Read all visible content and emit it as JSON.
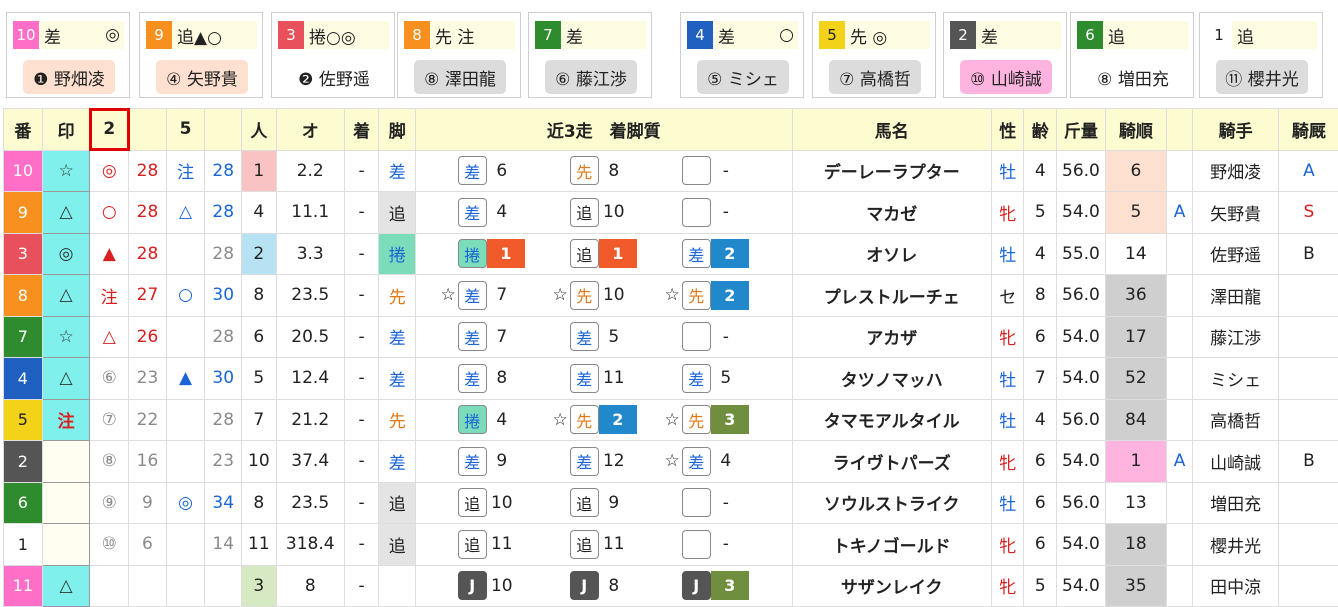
{
  "cards": [
    {
      "num": "10",
      "num_bg": "#ff6fc8",
      "mark": "差",
      "mark2": "◎",
      "jockey": "❶ 野畑凌",
      "jk_bg": "#fde0cf"
    },
    {
      "num": "9",
      "num_bg": "#f7901e",
      "mark": "追▲○",
      "mark2": "",
      "jockey": "④ 矢野貴",
      "jk_bg": "#fde0cf"
    },
    {
      "num": "3",
      "num_bg": "#e8505b",
      "mark": "捲○◎",
      "mark2": "",
      "jockey": "❷ 佐野遥",
      "jk_bg": "#ffffff"
    },
    {
      "num": "8",
      "num_bg": "#f7901e",
      "mark": "先 注",
      "mark2": "",
      "jockey": "⑧ 澤田龍",
      "jk_bg": "#dcdcdc"
    },
    {
      "num": "7",
      "num_bg": "#2e8b2e",
      "mark": "差",
      "mark2": "",
      "jockey": "⑥ 藤江渉",
      "jk_bg": "#dcdcdc"
    },
    {
      "num": "4",
      "num_bg": "#1f5fc0",
      "mark": "差",
      "mark2": "○",
      "jockey": "⑤ ミシェ",
      "jk_bg": "#dcdcdc"
    },
    {
      "num": "5",
      "num_bg": "#f3d31a",
      "mark": "先 ◎",
      "mark2": "",
      "jockey": "⑦ 高橋哲",
      "jk_bg": "#dcdcdc"
    },
    {
      "num": "2",
      "num_bg": "#555555",
      "mark": "差",
      "mark2": "",
      "jockey": "⑩ 山崎誠",
      "jk_bg": "#ffb4e0"
    },
    {
      "num": "6",
      "num_bg": "#2e8b2e",
      "mark": "追",
      "mark2": "",
      "jockey": "⑧ 増田充",
      "jk_bg": "#ffffff"
    },
    {
      "num": "1",
      "num_bg": "#ffffff",
      "mark": "追",
      "mark2": "",
      "jockey": "⑪ 櫻井光",
      "jk_bg": "#dcdcdc"
    }
  ],
  "headers": {
    "ban": "番",
    "mark": "印",
    "c2": "2",
    "c5": "5",
    "ninki": "人",
    "odds": "オ",
    "chaku": "着",
    "ashi": "脚",
    "recent": "近3走　着脚質",
    "name": "馬名",
    "sex": "性",
    "age": "齢",
    "kin": "斤量",
    "kijun": "騎順",
    "jockey": "騎手",
    "kikyu": "騎厩"
  },
  "rows": [
    {
      "ban": "10",
      "ban_bg": "#ff6fc8",
      "ban_fg": "#fff",
      "mark": "☆",
      "mark_style": "mark",
      "m2": "◎",
      "m2c": "red",
      "v2": "28",
      "v2c": "red",
      "m5": "注",
      "m5c": "blue",
      "v5": "28",
      "v5c": "blue",
      "ninki": "1",
      "ninki_bg": "#f9c3c3",
      "odds": "2.2",
      "chaku": "-",
      "ashi": "差",
      "ashi_c": "sa",
      "ashi_bg": "",
      "r": [
        {
          "st": "",
          "t": "差",
          "c": "sa",
          "n": "6",
          "rk": "",
          "rkbg": ""
        },
        {
          "st": "",
          "t": "先",
          "c": "se",
          "n": "8",
          "rk": "",
          "rkbg": ""
        },
        {
          "st": "",
          "t": "",
          "c": "blank",
          "n": "-",
          "rk": "",
          "rkbg": ""
        }
      ],
      "name": "デーレーラプター",
      "sex": "牡",
      "sexc": "blue",
      "age": "4",
      "kin": "56.0",
      "kijun": "6",
      "kj_bg": "#fde0cf",
      "a": "",
      "jockey": "野畑凌",
      "kikyu": "A",
      "kkc": "blue"
    },
    {
      "ban": "9",
      "ban_bg": "#f7901e",
      "ban_fg": "#fff",
      "mark": "△",
      "mark_style": "mark",
      "m2": "○",
      "m2c": "red",
      "v2": "28",
      "v2c": "red",
      "m5": "△",
      "m5c": "blue",
      "v5": "28",
      "v5c": "blue",
      "ninki": "4",
      "ninki_bg": "",
      "odds": "11.1",
      "chaku": "-",
      "ashi": "追",
      "ashi_c": "oi",
      "ashi_bg": "#e4e4e4",
      "r": [
        {
          "st": "",
          "t": "差",
          "c": "sa",
          "n": "4",
          "rk": "",
          "rkbg": ""
        },
        {
          "st": "",
          "t": "追",
          "c": "oi",
          "n": "10",
          "rk": "",
          "rkbg": ""
        },
        {
          "st": "",
          "t": "",
          "c": "blank",
          "n": "-",
          "rk": "",
          "rkbg": ""
        }
      ],
      "name": "マカゼ",
      "sex": "牝",
      "sexc": "red",
      "age": "5",
      "kin": "54.0",
      "kijun": "5",
      "kj_bg": "#fde0cf",
      "a": "A",
      "jockey": "矢野貴",
      "kikyu": "S",
      "kkc": "red"
    },
    {
      "ban": "3",
      "ban_bg": "#e8505b",
      "ban_fg": "#fff",
      "mark": "◎",
      "mark_style": "mark",
      "m2": "▲",
      "m2c": "red",
      "v2": "28",
      "v2c": "red",
      "m5": "",
      "m5c": "",
      "v5": "28",
      "v5c": "gray",
      "ninki": "2",
      "ninki_bg": "#b7e2f3",
      "odds": "3.3",
      "chaku": "-",
      "ashi": "捲",
      "ashi_c": "ma",
      "ashi_bg": "#7adcb8",
      "r": [
        {
          "st": "",
          "t": "捲",
          "c": "ma",
          "n": "",
          "rk": "1",
          "rkbg": "#f15a2a"
        },
        {
          "st": "",
          "t": "追",
          "c": "oi",
          "n": "",
          "rk": "1",
          "rkbg": "#f15a2a"
        },
        {
          "st": "",
          "t": "差",
          "c": "sa",
          "n": "",
          "rk": "2",
          "rkbg": "#2288cc"
        }
      ],
      "name": "オソレ",
      "sex": "牡",
      "sexc": "blue",
      "age": "4",
      "kin": "55.0",
      "kijun": "14",
      "kj_bg": "",
      "a": "",
      "jockey": "佐野遥",
      "kikyu": "B",
      "kkc": ""
    },
    {
      "ban": "8",
      "ban_bg": "#f7901e",
      "ban_fg": "#fff",
      "mark": "△",
      "mark_style": "mark",
      "m2": "注",
      "m2c": "red",
      "v2": "27",
      "v2c": "red",
      "m5": "○",
      "m5c": "blue",
      "v5": "30",
      "v5c": "blue",
      "ninki": "8",
      "ninki_bg": "",
      "odds": "23.5",
      "chaku": "-",
      "ashi": "先",
      "ashi_c": "se",
      "ashi_bg": "",
      "r": [
        {
          "st": "☆",
          "t": "差",
          "c": "sa",
          "n": "7",
          "rk": "",
          "rkbg": ""
        },
        {
          "st": "☆",
          "t": "先",
          "c": "se",
          "n": "10",
          "rk": "",
          "rkbg": ""
        },
        {
          "st": "☆",
          "t": "先",
          "c": "se",
          "n": "",
          "rk": "2",
          "rkbg": "#2288cc"
        }
      ],
      "name": "プレストルーチェ",
      "sex": "セ",
      "sexc": "",
      "age": "8",
      "kin": "56.0",
      "kijun": "36",
      "kj_bg": "#cfcfcf",
      "a": "",
      "jockey": "澤田龍",
      "kikyu": "",
      "kkc": ""
    },
    {
      "ban": "7",
      "ban_bg": "#2e8b2e",
      "ban_fg": "#fff",
      "mark": "☆",
      "mark_style": "mark",
      "m2": "△",
      "m2c": "red",
      "v2": "26",
      "v2c": "red",
      "m5": "",
      "m5c": "",
      "v5": "28",
      "v5c": "gray",
      "ninki": "6",
      "ninki_bg": "",
      "odds": "20.5",
      "chaku": "-",
      "ashi": "差",
      "ashi_c": "sa",
      "ashi_bg": "",
      "r": [
        {
          "st": "",
          "t": "差",
          "c": "sa",
          "n": "7",
          "rk": "",
          "rkbg": ""
        },
        {
          "st": "",
          "t": "差",
          "c": "sa",
          "n": "5",
          "rk": "",
          "rkbg": ""
        },
        {
          "st": "",
          "t": "",
          "c": "blank",
          "n": "-",
          "rk": "",
          "rkbg": ""
        }
      ],
      "name": "アカザ",
      "sex": "牝",
      "sexc": "red",
      "age": "6",
      "kin": "54.0",
      "kijun": "17",
      "kj_bg": "#cfcfcf",
      "a": "",
      "jockey": "藤江渉",
      "kikyu": "",
      "kkc": ""
    },
    {
      "ban": "4",
      "ban_bg": "#1f5fc0",
      "ban_fg": "#fff",
      "mark": "△",
      "mark_style": "mark",
      "m2": "⑥",
      "m2c": "gray",
      "v2": "23",
      "v2c": "gray",
      "m5": "▲",
      "m5c": "blue",
      "v5": "30",
      "v5c": "blue",
      "ninki": "5",
      "ninki_bg": "",
      "odds": "12.4",
      "chaku": "-",
      "ashi": "差",
      "ashi_c": "sa",
      "ashi_bg": "",
      "r": [
        {
          "st": "",
          "t": "差",
          "c": "sa",
          "n": "8",
          "rk": "",
          "rkbg": ""
        },
        {
          "st": "",
          "t": "差",
          "c": "sa",
          "n": "11",
          "rk": "",
          "rkbg": ""
        },
        {
          "st": "",
          "t": "差",
          "c": "sa",
          "n": "5",
          "rk": "",
          "rkbg": ""
        }
      ],
      "name": "タツノマッハ",
      "sex": "牡",
      "sexc": "blue",
      "age": "7",
      "kin": "54.0",
      "kijun": "52",
      "kj_bg": "#cfcfcf",
      "a": "",
      "jockey": "ミシェ",
      "kikyu": "",
      "kkc": ""
    },
    {
      "ban": "5",
      "ban_bg": "#f3d31a",
      "ban_fg": "#222",
      "mark": "注",
      "mark_style": "mark",
      "m2": "⑦",
      "m2c": "gray",
      "v2": "22",
      "v2c": "gray",
      "m5": "",
      "m5c": "",
      "v5": "28",
      "v5c": "gray",
      "ninki": "7",
      "ninki_bg": "",
      "odds": "21.2",
      "chaku": "-",
      "ashi": "先",
      "ashi_c": "se",
      "ashi_bg": "",
      "r": [
        {
          "st": "",
          "t": "捲",
          "c": "ma",
          "n": "4",
          "rk": "",
          "rkbg": ""
        },
        {
          "st": "☆",
          "t": "先",
          "c": "se",
          "n": "",
          "rk": "2",
          "rkbg": "#2288cc"
        },
        {
          "st": "☆",
          "t": "先",
          "c": "se",
          "n": "",
          "rk": "3",
          "rkbg": "#6f8f3e"
        }
      ],
      "name": "タマモアルタイル",
      "sex": "牡",
      "sexc": "blue",
      "age": "4",
      "kin": "56.0",
      "kijun": "84",
      "kj_bg": "#cfcfcf",
      "a": "",
      "jockey": "高橋哲",
      "kikyu": "",
      "kkc": ""
    },
    {
      "ban": "2",
      "ban_bg": "#555555",
      "ban_fg": "#fff",
      "mark": "",
      "mark_style": "markw",
      "m2": "⑧",
      "m2c": "gray",
      "v2": "16",
      "v2c": "gray",
      "m5": "",
      "m5c": "",
      "v5": "23",
      "v5c": "gray",
      "ninki": "10",
      "ninki_bg": "",
      "odds": "37.4",
      "chaku": "-",
      "ashi": "差",
      "ashi_c": "sa",
      "ashi_bg": "",
      "r": [
        {
          "st": "",
          "t": "差",
          "c": "sa",
          "n": "9",
          "rk": "",
          "rkbg": ""
        },
        {
          "st": "",
          "t": "差",
          "c": "sa",
          "n": "12",
          "rk": "",
          "rkbg": ""
        },
        {
          "st": "☆",
          "t": "差",
          "c": "sa",
          "n": "4",
          "rk": "",
          "rkbg": ""
        }
      ],
      "name": "ライヴトパーズ",
      "sex": "牝",
      "sexc": "red",
      "age": "6",
      "kin": "54.0",
      "kijun": "1",
      "kj_bg": "#ffb4e0",
      "a": "A",
      "jockey": "山崎誠",
      "kikyu": "B",
      "kkc": ""
    },
    {
      "ban": "6",
      "ban_bg": "#2e8b2e",
      "ban_fg": "#fff",
      "mark": "",
      "mark_style": "markw",
      "m2": "⑨",
      "m2c": "gray",
      "v2": "9",
      "v2c": "gray",
      "m5": "◎",
      "m5c": "blue",
      "v5": "34",
      "v5c": "blue",
      "ninki": "8",
      "ninki_bg": "",
      "odds": "23.5",
      "chaku": "-",
      "ashi": "追",
      "ashi_c": "oi",
      "ashi_bg": "#e4e4e4",
      "r": [
        {
          "st": "",
          "t": "追",
          "c": "oi",
          "n": "10",
          "rk": "",
          "rkbg": ""
        },
        {
          "st": "",
          "t": "追",
          "c": "oi",
          "n": "9",
          "rk": "",
          "rkbg": ""
        },
        {
          "st": "",
          "t": "",
          "c": "blank",
          "n": "-",
          "rk": "",
          "rkbg": ""
        }
      ],
      "name": "ソウルストライク",
      "sex": "牡",
      "sexc": "blue",
      "age": "6",
      "kin": "56.0",
      "kijun": "13",
      "kj_bg": "",
      "a": "",
      "jockey": "増田充",
      "kikyu": "",
      "kkc": ""
    },
    {
      "ban": "1",
      "ban_bg": "#ffffff",
      "ban_fg": "#222",
      "mark": "",
      "mark_style": "markw",
      "m2": "⑩",
      "m2c": "gray",
      "v2": "6",
      "v2c": "gray",
      "m5": "",
      "m5c": "",
      "v5": "14",
      "v5c": "gray",
      "ninki": "11",
      "ninki_bg": "",
      "odds": "318.4",
      "chaku": "-",
      "ashi": "追",
      "ashi_c": "oi",
      "ashi_bg": "#e4e4e4",
      "r": [
        {
          "st": "",
          "t": "追",
          "c": "oi",
          "n": "11",
          "rk": "",
          "rkbg": ""
        },
        {
          "st": "",
          "t": "追",
          "c": "oi",
          "n": "11",
          "rk": "",
          "rkbg": ""
        },
        {
          "st": "",
          "t": "",
          "c": "blank",
          "n": "-",
          "rk": "",
          "rkbg": ""
        }
      ],
      "name": "トキノゴールド",
      "sex": "牝",
      "sexc": "red",
      "age": "6",
      "kin": "54.0",
      "kijun": "18",
      "kj_bg": "#cfcfcf",
      "a": "",
      "jockey": "櫻井光",
      "kikyu": "",
      "kkc": ""
    },
    {
      "ban": "11",
      "ban_bg": "#ff6fc8",
      "ban_fg": "#fff",
      "mark": "△",
      "mark_style": "mark",
      "m2": "",
      "m2c": "",
      "v2": "",
      "v2c": "",
      "m5": "",
      "m5c": "",
      "v5": "",
      "v5c": "",
      "ninki": "3",
      "ninki_bg": "#d7e9c3",
      "odds": "8",
      "chaku": "-",
      "ashi": "",
      "ashi_c": "",
      "ashi_bg": "",
      "r": [
        {
          "st": "",
          "t": "J",
          "c": "jj",
          "n": "10",
          "rk": "",
          "rkbg": ""
        },
        {
          "st": "",
          "t": "J",
          "c": "jj",
          "n": "8",
          "rk": "",
          "rkbg": ""
        },
        {
          "st": "",
          "t": "J",
          "c": "jj",
          "n": "",
          "rk": "3",
          "rkbg": "#6f8f3e"
        }
      ],
      "name": "サザンレイク",
      "sex": "牝",
      "sexc": "red",
      "age": "5",
      "kin": "54.0",
      "kijun": "35",
      "kj_bg": "#cfcfcf",
      "a": "",
      "jockey": "田中涼",
      "kikyu": "",
      "kkc": ""
    }
  ]
}
